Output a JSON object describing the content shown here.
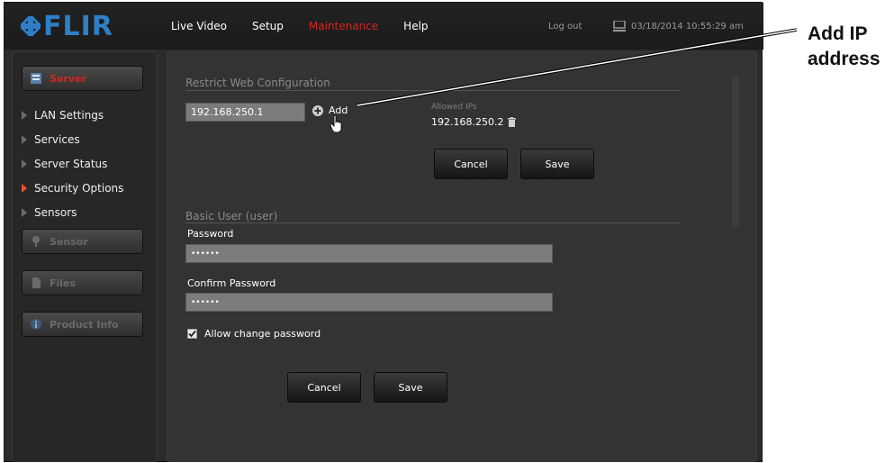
{
  "brand": {
    "name": "FLIR",
    "color": "#2f7fc6"
  },
  "nav": {
    "items": [
      {
        "label": "Live Video",
        "active": false
      },
      {
        "label": "Setup",
        "active": false
      },
      {
        "label": "Maintenance",
        "active": true
      },
      {
        "label": "Help",
        "active": false
      }
    ],
    "logout_label": "Log out",
    "datetime": "03/18/2014 10:55:29 am",
    "active_color": "#d2271f"
  },
  "sidebar": {
    "buttons": [
      {
        "label": "Server",
        "icon": "server-icon",
        "active": true
      },
      {
        "label": "Sensor",
        "icon": "sensor-icon",
        "active": false
      },
      {
        "label": "Files",
        "icon": "file-icon",
        "active": false
      },
      {
        "label": "Product Info",
        "icon": "info-icon",
        "active": false
      }
    ],
    "menu": [
      {
        "label": "LAN Settings",
        "active": false
      },
      {
        "label": "Services",
        "active": false
      },
      {
        "label": "Server Status",
        "active": false
      },
      {
        "label": "Security Options",
        "active": true
      },
      {
        "label": "Sensors",
        "active": false
      }
    ]
  },
  "restrict": {
    "title": "Restrict Web Configuration",
    "ip_value": "192.168.250.1",
    "add_label": "Add",
    "allowed_heading": "Allowed IPs",
    "allowed_ips": [
      "192.168.250.2"
    ],
    "cancel_label": "Cancel",
    "save_label": "Save"
  },
  "basic_user": {
    "title": "Basic User (user)",
    "password_label": "Password",
    "password_value": "••••••",
    "confirm_label": "Confirm Password",
    "confirm_value": "••••••",
    "allow_change_label": "Allow change password",
    "allow_change_checked": true,
    "cancel_label": "Cancel",
    "save_label": "Save"
  },
  "annotation": {
    "line1": "Add IP",
    "line2": "address"
  }
}
